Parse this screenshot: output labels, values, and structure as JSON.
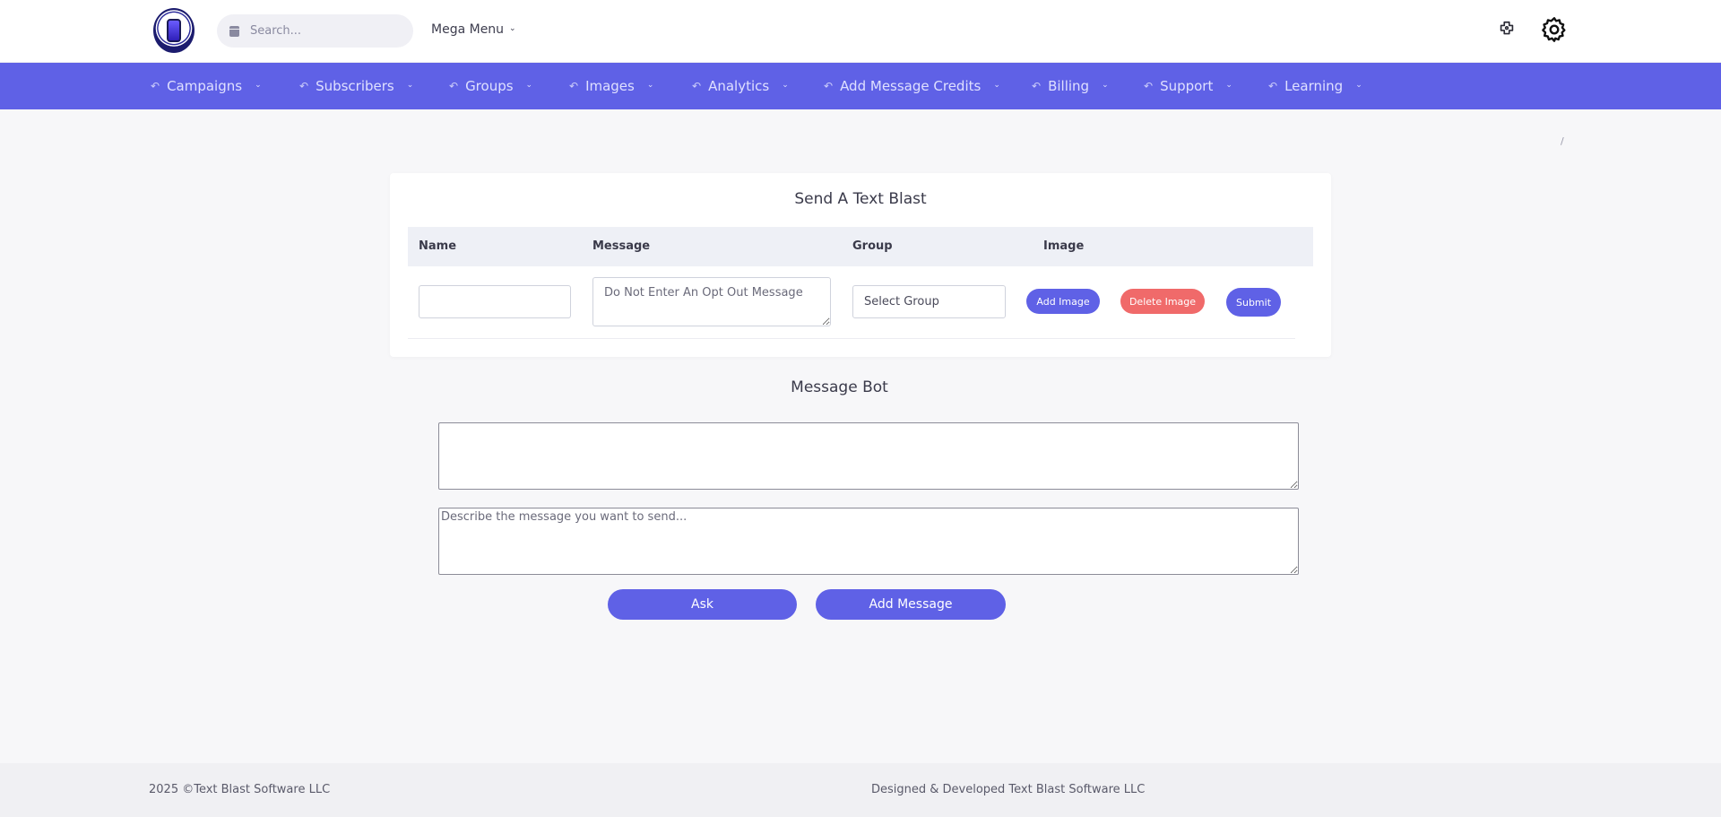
{
  "header": {
    "search_placeholder": "Search...",
    "mega_menu_label": "Mega Menu",
    "icons": [
      "app-logo-icon",
      "calendar-icon",
      "plugin-icon",
      "gear-icon"
    ]
  },
  "nav": {
    "items": [
      {
        "label": "Campaigns"
      },
      {
        "label": "Subscribers"
      },
      {
        "label": "Groups"
      },
      {
        "label": "Images"
      },
      {
        "label": "Analytics"
      },
      {
        "label": "Add Message Credits"
      },
      {
        "label": "Billing"
      },
      {
        "label": "Support"
      },
      {
        "label": "Learning"
      }
    ]
  },
  "breadcrumb": {
    "separator": "/"
  },
  "blast_card": {
    "title": "Send A Text Blast",
    "columns": [
      "Name",
      "Message",
      "Group",
      "Image"
    ],
    "message_placeholder": "Do Not Enter An Opt Out Message",
    "group_select_value": "Select Group",
    "add_image_label": "Add Image",
    "delete_image_label": "Delete Image",
    "submit_label": "Submit"
  },
  "message_bot": {
    "title": "Message Bot",
    "prompt_placeholder": "Describe the message you want to send...",
    "ask_label": "Ask",
    "add_message_label": "Add Message"
  },
  "footer": {
    "copyright": "2025 ©Text Blast Software LLC",
    "credits": "Designed & Developed Text Blast Software LLC"
  },
  "colors": {
    "primary": "#5f61e6",
    "danger": "#f06a6a",
    "background": "#f7f7f9"
  }
}
